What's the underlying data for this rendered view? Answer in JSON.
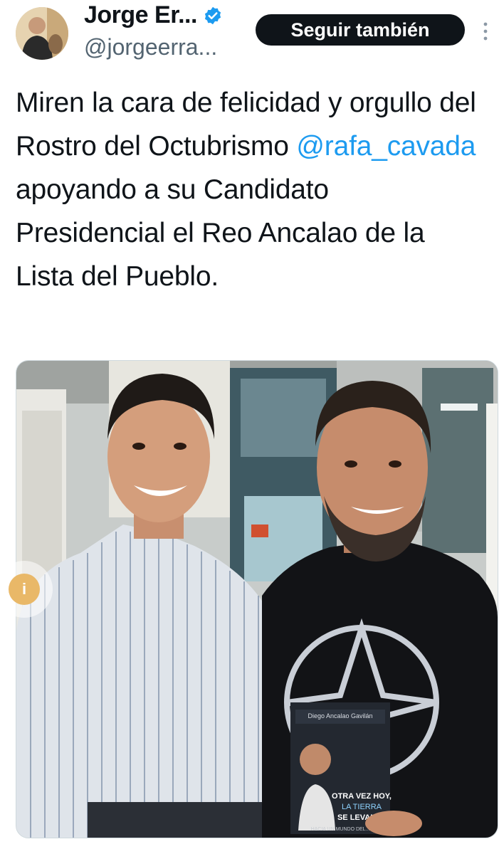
{
  "author": {
    "display_name": "Jorge Er...",
    "handle": "@jorgeerra...",
    "verified_icon": "verified-badge-icon"
  },
  "actions": {
    "follow_label": "Seguir también",
    "more_icon": "more-vertical-icon"
  },
  "tweet": {
    "text_part1": "Miren la cara de felicidad y orgullo del Rostro del Octubrismo ",
    "mention": "@rafa_cavada",
    "text_part2": " apoyando a su Candidato Presidencial el Reo Ancalao de la Lista del Pueblo."
  },
  "photo": {
    "book_author": "Diego Ancalao Gavilán",
    "book_title_line1": "OTRA VEZ HOY,",
    "book_title_line2": "LA TIERRA",
    "book_title_line3": "SE LEVANTA",
    "book_subtitle": "HACIA UN MUNDO DEL..."
  },
  "colors": {
    "accent": "#1d9bf0",
    "text": "#0f1419",
    "secondary": "#536471",
    "button_bg": "#0f1419"
  }
}
